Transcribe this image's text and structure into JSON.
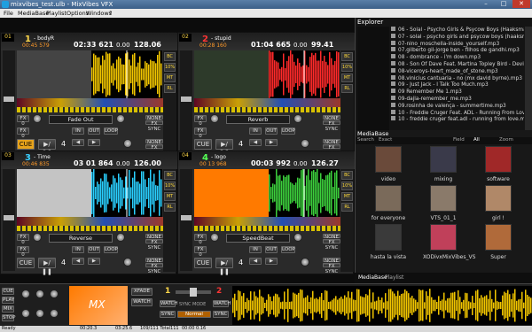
{
  "window": {
    "title": "mixvibes_test.ulb - MixVibes VFX",
    "minimize": "–",
    "maximize": "□",
    "close": "✕"
  },
  "menu": [
    "File",
    "MediaBase",
    "Playlist",
    "Options",
    "Windows",
    "?"
  ],
  "decks": [
    {
      "pos": "01",
      "num": "1",
      "name": "- bodyR",
      "elapsed": "00:45 579",
      "remain": "02:33 621",
      "pitch": "0.00",
      "bpm": "128.06",
      "effect": "Fade Out",
      "color": "#ffd84a",
      "wave": "#f2c600",
      "cue": "CUE",
      "loop": "4",
      "sync": "FX SYNC"
    },
    {
      "pos": "02",
      "num": "2",
      "name": "- stupid",
      "elapsed": "00:28 160",
      "remain": "01:04 665",
      "pitch": "0.00",
      "bpm": "99.41",
      "effect": "Reverb",
      "color": "#ff3535",
      "wave": "#ff2a2a",
      "cue": "CUE",
      "loop": "4",
      "sync": "FX SYNC"
    },
    {
      "pos": "03",
      "num": "3",
      "name": "- Time",
      "elapsed": "00:46 835",
      "remain": "03 01 864",
      "pitch": "0.00",
      "bpm": "126.00",
      "effect": "Reverse",
      "color": "#3acfff",
      "wave": "#2ad0ff",
      "cue": "CUE",
      "loop": "4",
      "sync": "FX SYNC"
    },
    {
      "pos": "04",
      "num": "4",
      "name": "- logo",
      "elapsed": "00 13 968",
      "remain": "00:03 992",
      "pitch": "0.00",
      "bpm": "126.27",
      "effect": "SpeedBeat",
      "color": "#55ff55",
      "wave": "#3ccf3c",
      "cue": "CUE",
      "loop": "4",
      "sync": "FX SYNC"
    }
  ],
  "deck_labels": {
    "fx": "FX 0",
    "in": "IN",
    "out": "OUT",
    "loop": "LOOP",
    "none": "NONE",
    "bc": "BC",
    "percent": "10%",
    "mt": "MT",
    "rl": "RL"
  },
  "explorer": {
    "title": "Explorer",
    "files": [
      "06 - Solal - Psycho Girls & Psycow Boys (Haaksmaa",
      "07 - solal - psycho girls and psycow boys (haaksma",
      "07-nino_moschella-inside_yourself.mp3",
      "07.gilberto gil-jorge ben - filhos de gandhi.mp3",
      "08 - dombrance - i'm down.mp3",
      "08 - Son Of Dave Feat. Martina Topley Bird - Devil",
      "08-viceroys-heart_made_of_stone.mp3",
      "08.vinicius cantuaria - no (mx david byrne).mp3",
      "09 - Just Jack - I Talk Too Much.mp3",
      "09 Remember Me 1.mp3",
      "09-dajla-remember_me.mp3",
      "09.rosinha de valença - summertime.mp3",
      "10 - Freddie Cruger Feat. ADL - Running From Love",
      "10 - freddie cruger feat.adl - running from love.mp"
    ]
  },
  "mediabase": {
    "title": "MediaBase",
    "search_label": "Search",
    "search_value": "Exact",
    "field_label": "Field",
    "field_value": "All",
    "zoom_label": "Zoom",
    "tiles": [
      {
        "label": "video",
        "color": "#6a4a3a"
      },
      {
        "label": "mixing",
        "color": "#3a3a4a"
      },
      {
        "label": "software",
        "color": "#a02828"
      },
      {
        "label": "for everyone",
        "color": "#7a6a5a"
      },
      {
        "label": "VTS_01_1",
        "color": "#8a7a6a"
      },
      {
        "label": "girl !",
        "color": "#b08868"
      },
      {
        "label": "hasta la vista",
        "color": "#3a3a3a"
      },
      {
        "label": "XODivxMixVibes_VS",
        "color": "#c0405a"
      },
      {
        "label": "Super",
        "color": "#b06a3a"
      }
    ],
    "tab_mediabase": "MediaBase",
    "tab_playlist": "Playlist"
  },
  "bottom": {
    "deck1": "1",
    "deck2": "2",
    "normal": "Normal",
    "sync_mode": "SYNC MODE",
    "cue": "CUE",
    "play": "PLAY",
    "mix": "MIX",
    "stop": "STOP",
    "xfade": "XFADE",
    "watch": "WATCH",
    "sync": "SYNC"
  },
  "status": {
    "ready": "Ready",
    "t1": "00:20.3",
    "t2": "03:25.6",
    "count": "109/111  Total111",
    "t3": "00:00 0.16"
  }
}
